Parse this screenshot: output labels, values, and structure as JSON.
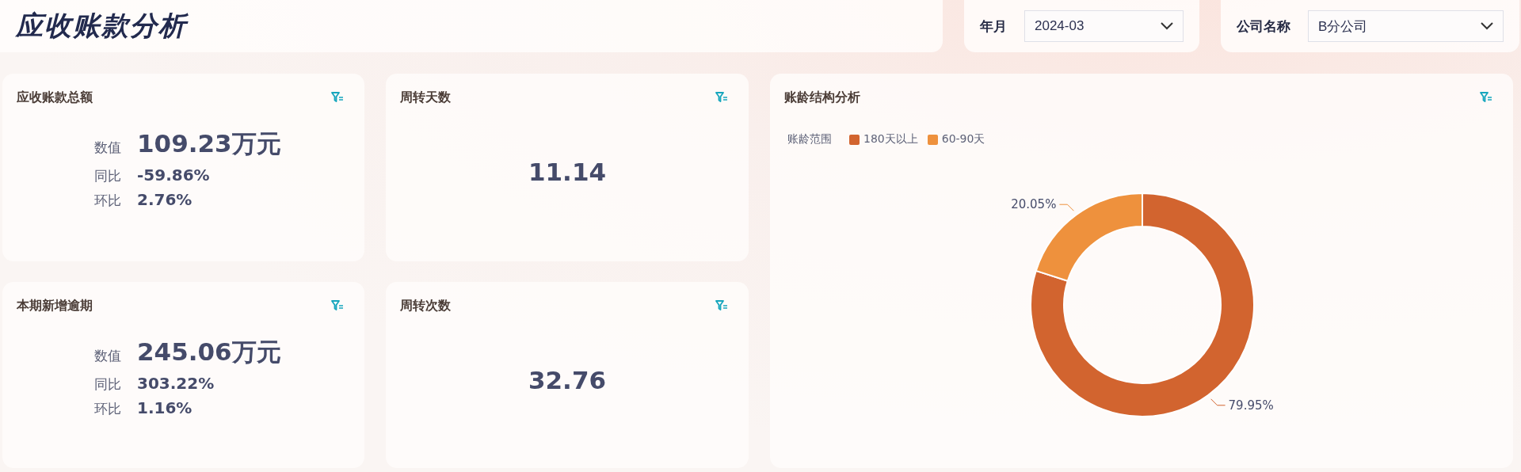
{
  "header": {
    "title": "应收账款分析",
    "filters": [
      {
        "label": "年月",
        "value": "2024-03"
      },
      {
        "label": "公司名称",
        "value": "B分公司"
      }
    ]
  },
  "cards": [
    {
      "kind": "metrics",
      "title": "应收账款总额",
      "rows": [
        {
          "kind": "main",
          "label": "数值",
          "value": "109.23万元"
        },
        {
          "kind": "sub",
          "label": "同比",
          "value": "-59.86%"
        },
        {
          "kind": "sub",
          "label": "环比",
          "value": "2.76%"
        }
      ]
    },
    {
      "kind": "single",
      "title": "周转天数",
      "value": "11.14"
    },
    {
      "kind": "metrics",
      "title": "本期新增逾期",
      "rows": [
        {
          "kind": "main",
          "label": "数值",
          "value": "245.06万元"
        },
        {
          "kind": "sub",
          "label": "同比",
          "value": "303.22%"
        },
        {
          "kind": "sub",
          "label": "环比",
          "value": "1.16%"
        }
      ]
    },
    {
      "kind": "single",
      "title": "周转次数",
      "value": "32.76"
    }
  ],
  "chart_card": {
    "title": "账龄结构分析",
    "legend": {
      "title": "账龄范围",
      "items": [
        {
          "color": "#d2642f"
        },
        {
          "color": "#ee913d"
        }
      ]
    },
    "chart_data": {
      "type": "donut",
      "categories": [
        "180天以上",
        "60-90天"
      ],
      "values": [
        79.95,
        20.05
      ],
      "data_labels": true,
      "value_labels": [
        "79.95%",
        "20.05%"
      ]
    }
  }
}
